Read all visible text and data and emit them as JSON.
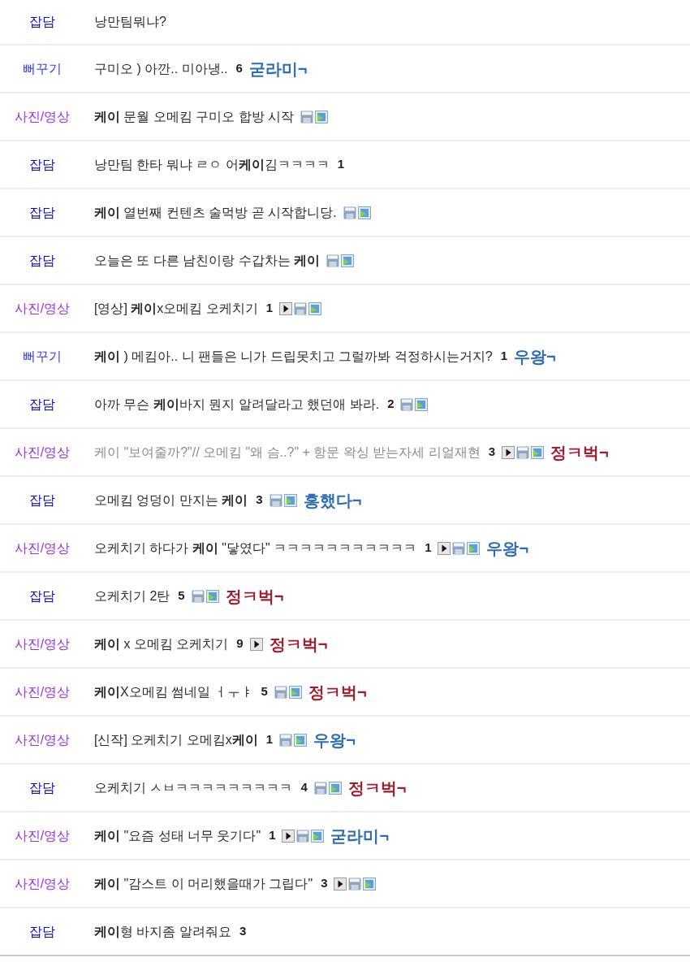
{
  "rows": [
    {
      "category": {
        "label": "잡담",
        "color": "#0b0bbf"
      },
      "title": "낭만팀뭐냐?",
      "dimmed": false
    },
    {
      "category": {
        "label": "뻐꾸기",
        "color": "#2b35f5"
      },
      "title": "구미오 ) 아깐.. 미아냉..",
      "dimmed": false,
      "comment_count": "6",
      "badge": {
        "text": "굳라미¬",
        "color": "#2d6db3"
      }
    },
    {
      "category": {
        "label": "사진/영상",
        "color": "#9b30e6"
      },
      "title": "**케이** 문월 오메킴 구미오 합방 시작",
      "dimmed": false,
      "icons": [
        {
          "kind": "file"
        },
        {
          "kind": "image"
        }
      ]
    },
    {
      "category": {
        "label": "잡담",
        "color": "#0b0bbf"
      },
      "title": "낭만팀 한타 뭐냐 ㄹㅇ 어**케이**김ㅋㅋㅋㅋ",
      "dimmed": false,
      "comment_count": "1"
    },
    {
      "category": {
        "label": "잡담",
        "color": "#0b0bbf"
      },
      "title": "**케이** 열번째 컨텐츠 술먹방 곧 시작합니당.",
      "dimmed": false,
      "icons": [
        {
          "kind": "file"
        },
        {
          "kind": "image"
        }
      ]
    },
    {
      "category": {
        "label": "잡담",
        "color": "#0b0bbf"
      },
      "title": "오늘은 또 다른 남친이랑 수갑차는 **케이**",
      "dimmed": false,
      "icons": [
        {
          "kind": "file"
        },
        {
          "kind": "image"
        }
      ]
    },
    {
      "category": {
        "label": "사진/영상",
        "color": "#9b30e6"
      },
      "title": "[영상] **케이**x오메킴 오케치기",
      "dimmed": false,
      "comment_count": "1",
      "icons": [
        {
          "kind": "video"
        },
        {
          "kind": "file"
        },
        {
          "kind": "image"
        }
      ]
    },
    {
      "category": {
        "label": "뻐꾸기",
        "color": "#2b35f5"
      },
      "title": "**케이** ) 메킴아.. 니 팬들은 니가 드립못치고 그럴까봐 걱정하시는거지?",
      "dimmed": false,
      "comment_count": "1",
      "badge": {
        "text": "우왕¬",
        "color": "#2d6db3"
      }
    },
    {
      "category": {
        "label": "잡담",
        "color": "#0b0bbf"
      },
      "title": "아까 무슨 **케이**바지 뭔지 알려달라고 했던애 봐라.",
      "dimmed": false,
      "comment_count": "2",
      "icons": [
        {
          "kind": "file"
        },
        {
          "kind": "image"
        }
      ]
    },
    {
      "category": {
        "label": "사진/영상",
        "color": "#9b30e6"
      },
      "title": "케이 \"보여줄까?\"// 오메킴 \"왜 슴..?\" + 항문 왁싱 받는자세 리얼재현",
      "dimmed": true,
      "comment_count": "3",
      "icons": [
        {
          "kind": "video"
        },
        {
          "kind": "file"
        },
        {
          "kind": "image"
        }
      ],
      "badge": {
        "text": "정ㅋ벅¬",
        "color": "#a01c2c"
      }
    },
    {
      "category": {
        "label": "잡담",
        "color": "#0b0bbf"
      },
      "title": "오메킴 엉덩이 만지는 **케이**",
      "dimmed": false,
      "comment_count": "3",
      "icons": [
        {
          "kind": "file"
        },
        {
          "kind": "image"
        }
      ],
      "badge": {
        "text": "홍했다¬",
        "color": "#2d6db3"
      }
    },
    {
      "category": {
        "label": "사진/영상",
        "color": "#9b30e6"
      },
      "title": "오케치기 하다가 **케이** \"닿였다\" ㅋㅋㅋㅋㅋㅋㅋㅋㅋㅋㅋ",
      "dimmed": false,
      "comment_count": "1",
      "icons": [
        {
          "kind": "video"
        },
        {
          "kind": "file"
        },
        {
          "kind": "image"
        }
      ],
      "badge": {
        "text": "우왕¬",
        "color": "#2d6db3"
      }
    },
    {
      "category": {
        "label": "잡담",
        "color": "#0b0bbf"
      },
      "title": "오케치기 2탄",
      "dimmed": false,
      "comment_count": "5",
      "icons": [
        {
          "kind": "file"
        },
        {
          "kind": "image"
        }
      ],
      "badge": {
        "text": "정ㅋ벅¬",
        "color": "#a01c2c"
      }
    },
    {
      "category": {
        "label": "사진/영상",
        "color": "#9b30e6"
      },
      "title": "**케이** x 오메킴 오케치기",
      "dimmed": false,
      "comment_count": "9",
      "icons": [
        {
          "kind": "video"
        }
      ],
      "badge": {
        "text": "정ㅋ벅¬",
        "color": "#a01c2c"
      }
    },
    {
      "category": {
        "label": "사진/영상",
        "color": "#9b30e6"
      },
      "title": "**케이**X오메킴 썸네일 ㅓㅜㅑ",
      "dimmed": false,
      "comment_count": "5",
      "icons": [
        {
          "kind": "file"
        },
        {
          "kind": "image"
        }
      ],
      "badge": {
        "text": "정ㅋ벅¬",
        "color": "#a01c2c"
      }
    },
    {
      "category": {
        "label": "사진/영상",
        "color": "#9b30e6"
      },
      "title": "[신작] 오케치기 오메킴x**케이**",
      "dimmed": false,
      "comment_count": "1",
      "icons": [
        {
          "kind": "file"
        },
        {
          "kind": "image"
        }
      ],
      "badge": {
        "text": "우왕¬",
        "color": "#2d6db3"
      }
    },
    {
      "category": {
        "label": "잡담",
        "color": "#0b0bbf"
      },
      "title": "오케치기 ㅅㅂㅋㅋㅋㅋㅋㅋㅋㅋㅋ",
      "dimmed": false,
      "comment_count": "4",
      "icons": [
        {
          "kind": "file"
        },
        {
          "kind": "image"
        }
      ],
      "badge": {
        "text": "정ㅋ벅¬",
        "color": "#a01c2c"
      }
    },
    {
      "category": {
        "label": "사진/영상",
        "color": "#9b30e6"
      },
      "title": "**케이** \"요즘 성태 너무 웃기다\"",
      "dimmed": false,
      "comment_count": "1",
      "icons": [
        {
          "kind": "video"
        },
        {
          "kind": "file"
        },
        {
          "kind": "image"
        }
      ],
      "badge": {
        "text": "굳라미¬",
        "color": "#2d6db3"
      }
    },
    {
      "category": {
        "label": "사진/영상",
        "color": "#9b30e6"
      },
      "title": "**케이** \"감스트 이 머리했을때가 그립다\"",
      "dimmed": false,
      "comment_count": "3",
      "icons": [
        {
          "kind": "video"
        },
        {
          "kind": "file"
        },
        {
          "kind": "image"
        }
      ]
    },
    {
      "category": {
        "label": "잡담",
        "color": "#0b0bbf"
      },
      "title": "**케이**형 바지좀 알려줘요",
      "dimmed": false,
      "comment_count": "3"
    }
  ]
}
